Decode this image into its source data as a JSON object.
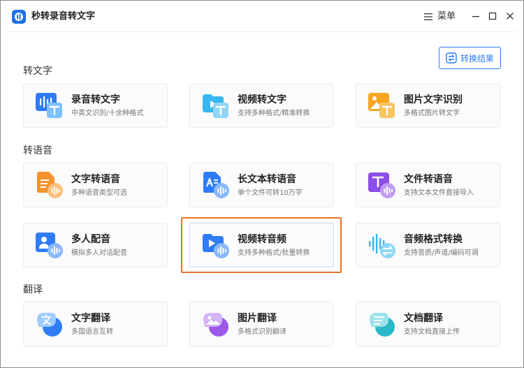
{
  "app": {
    "title": "秒转录音转文字"
  },
  "titlebar": {
    "menu_label": "菜单"
  },
  "toolbar": {
    "result_label": "转换结果"
  },
  "sections": [
    {
      "title": "转文字"
    },
    {
      "title": "转语音"
    },
    {
      "title": "翻译"
    }
  ],
  "cards": [
    {
      "title": "录音转文字",
      "subtitle": "中英文识别/十余种格式",
      "icon": "waveform-text-icon"
    },
    {
      "title": "视频转文字",
      "subtitle": "支持多种格式/精准转换",
      "icon": "video-text-icon"
    },
    {
      "title": "图片文字识别",
      "subtitle": "多格式图片转文字",
      "icon": "image-text-icon"
    },
    {
      "title": "文字转语音",
      "subtitle": "多种语音类型可选",
      "icon": "document-voice-icon"
    },
    {
      "title": "长文本转语音",
      "subtitle": "单个文件可转10万字",
      "icon": "long-text-voice-icon"
    },
    {
      "title": "文件转语音",
      "subtitle": "支持文本文件直接导入",
      "icon": "file-voice-icon"
    },
    {
      "title": "多人配音",
      "subtitle": "模拟多人对话配音",
      "icon": "multi-person-voice-icon"
    },
    {
      "title": "视频转音频",
      "subtitle": "支持多种格式/批量转换",
      "icon": "video-audio-icon"
    },
    {
      "title": "音频格式转换",
      "subtitle": "支持音质/声道/编码可调",
      "icon": "audio-convert-icon"
    },
    {
      "title": "文字翻译",
      "subtitle": "多国语言互转",
      "icon": "text-translate-icon"
    },
    {
      "title": "图片翻译",
      "subtitle": "多格式识别翻译",
      "icon": "image-translate-icon"
    },
    {
      "title": "文档翻译",
      "subtitle": "支持文档直接上传",
      "icon": "document-translate-icon"
    }
  ],
  "colors": {
    "accent": "#2f7cf6",
    "highlight": "#e8722a"
  }
}
